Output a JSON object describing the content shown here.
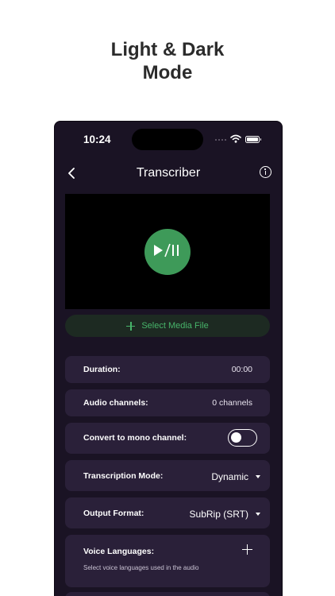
{
  "promo": {
    "title_line1": "Light & Dark",
    "title_line2": "Mode"
  },
  "status_bar": {
    "time": "10:24"
  },
  "nav": {
    "title": "Transcriber"
  },
  "media": {
    "select_label": "Select Media File"
  },
  "settings": {
    "duration": {
      "label": "Duration:",
      "value": "00:00"
    },
    "audio_channels": {
      "label": "Audio channels:",
      "value": "0 channels"
    },
    "mono": {
      "label": "Convert to mono channel:",
      "enabled": false
    },
    "transcription_mode": {
      "label": "Transcription Mode:",
      "value": "Dynamic"
    },
    "output_format": {
      "label": "Output Format:",
      "value": "SubRip (SRT)"
    },
    "voice_languages": {
      "label": "Voice Languages:",
      "hint": "Select voice languages used in the audio"
    }
  },
  "colors": {
    "background": "#1a1324",
    "card": "#2a2039",
    "accent_green": "#3e9a59",
    "accent_green_text": "#47b46a"
  },
  "icons": [
    "chevron-left-icon",
    "info-icon",
    "play-pause-icon",
    "plus-icon",
    "wifi-icon",
    "battery-icon",
    "caret-down-icon"
  ]
}
